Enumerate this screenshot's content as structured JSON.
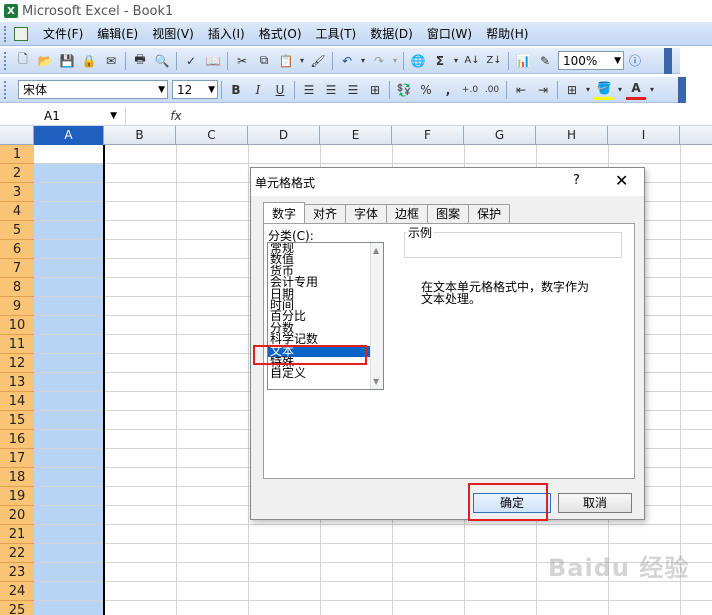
{
  "window": {
    "title": "Microsoft Excel - Book1",
    "app_icon": "excel-icon"
  },
  "menu": [
    "文件(F)",
    "编辑(E)",
    "视图(V)",
    "插入(I)",
    "格式(O)",
    "工具(T)",
    "数据(D)",
    "窗口(W)",
    "帮助(H)"
  ],
  "toolbar": {
    "zoom": "100%"
  },
  "format_bar": {
    "font": "宋体",
    "size": "12",
    "bold": "B",
    "italic": "I",
    "underline": "U",
    "percent": "%",
    "comma": ","
  },
  "formula_bar": {
    "cell_ref": "A1",
    "fx": "fx"
  },
  "columns": [
    "A",
    "B",
    "C",
    "D",
    "E",
    "F",
    "G",
    "H",
    "I"
  ],
  "rows": [
    "1",
    "2",
    "3",
    "4",
    "5",
    "6",
    "7",
    "8",
    "9",
    "10",
    "11",
    "12",
    "13",
    "14",
    "15",
    "16",
    "17",
    "18",
    "19",
    "20",
    "21",
    "22",
    "23",
    "24",
    "25"
  ],
  "dialog": {
    "title": "单元格格式",
    "help": "?",
    "close": "✕",
    "tabs": [
      "数字",
      "对齐",
      "字体",
      "边框",
      "图案",
      "保护"
    ],
    "active_tab": "数字",
    "category_label": "分类(C):",
    "categories": [
      "常规",
      "数值",
      "货币",
      "会计专用",
      "日期",
      "时间",
      "百分比",
      "分数",
      "科学记数",
      "文本",
      "特殊",
      "自定义"
    ],
    "selected_category": "文本",
    "sample_label": "示例",
    "description_line1": "在文本单元格格式中，数字作为",
    "description_line2": "文本处理。",
    "ok": "确定",
    "cancel": "取消"
  },
  "watermark": "Baidu 经验"
}
